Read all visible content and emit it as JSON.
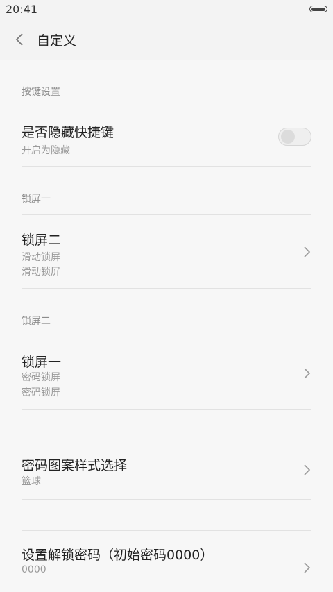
{
  "status_bar": {
    "time": "20:41"
  },
  "app_bar": {
    "title": "自定义"
  },
  "sections": {
    "keys": {
      "header": "按键设置",
      "hide_shortcut": {
        "title": "是否隐藏快捷键",
        "subtitle": "开启为隐藏",
        "enabled": false
      }
    },
    "lock1": {
      "header": "锁屏一",
      "item": {
        "title": "锁屏二",
        "line1": "滑动锁屏",
        "line2": "滑动锁屏"
      }
    },
    "lock2": {
      "header": "锁屏二",
      "item": {
        "title": "锁屏一",
        "line1": "密码锁屏",
        "line2": "密码锁屏"
      }
    },
    "pattern": {
      "title": "密码图案样式选择",
      "subtitle": "篮球"
    },
    "password": {
      "title": "设置解锁密码（初始密码0000）",
      "subtitle": "0000"
    }
  },
  "icons": {
    "back": "chevron-left",
    "chevron": "chevron-right",
    "battery": "battery-full"
  }
}
